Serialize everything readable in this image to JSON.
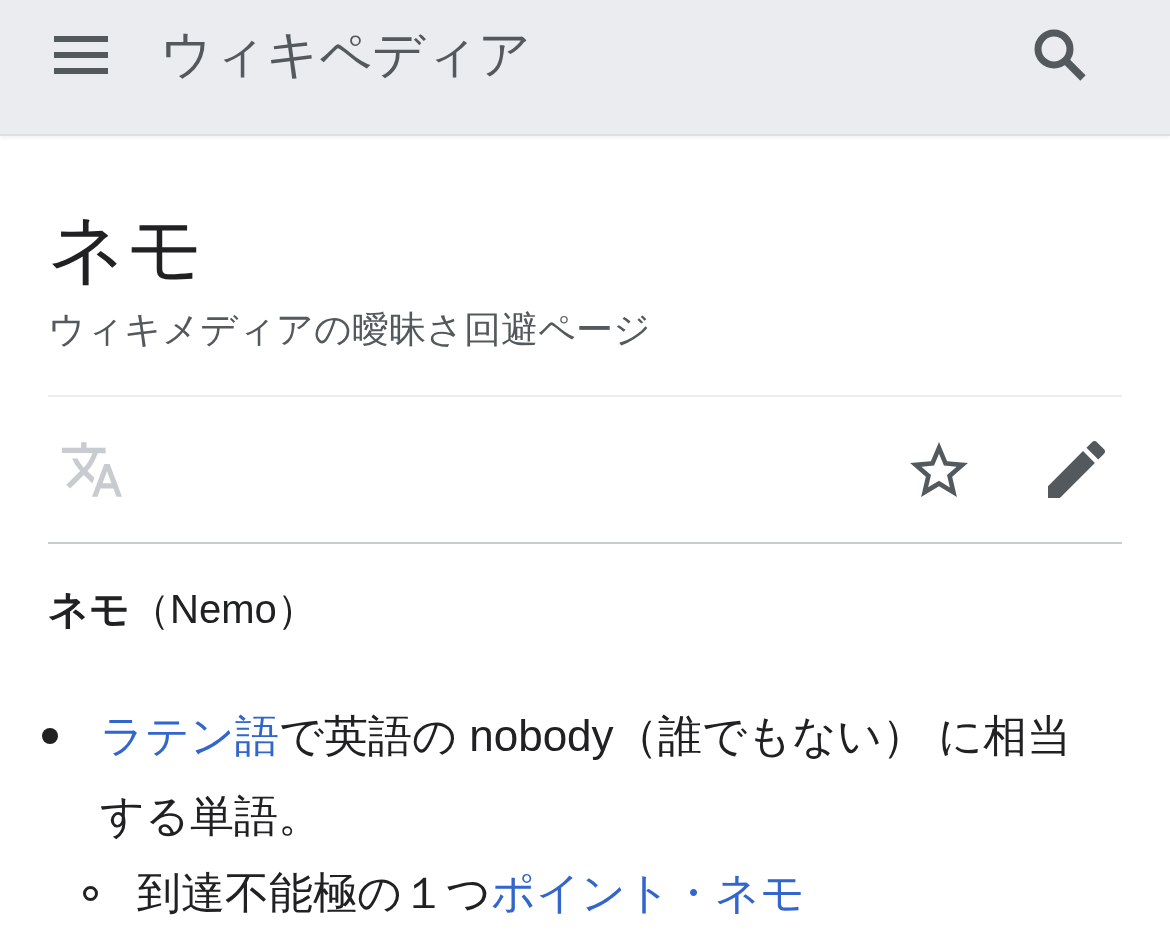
{
  "header": {
    "title": "ウィキペディア"
  },
  "page": {
    "title": "ネモ",
    "subtitle": "ウィキメディアの曖昧さ回避ページ"
  },
  "actions": {
    "language": {
      "disabled": true
    },
    "watch": {
      "watched": false
    }
  },
  "lead": "**ネモ**（Nemo）",
  "list": [
    {
      "segments": [
        {
          "kind": "link",
          "text": "ラテン語"
        },
        {
          "kind": "text",
          "text": "で英語の nobody（誰でもない） に相当する単語。"
        }
      ],
      "children": [
        {
          "segments": [
            {
              "kind": "text",
              "text": "到達不能極の１つ"
            },
            {
              "kind": "link",
              "text": "ポイント・ネモ"
            }
          ]
        }
      ]
    }
  ]
}
